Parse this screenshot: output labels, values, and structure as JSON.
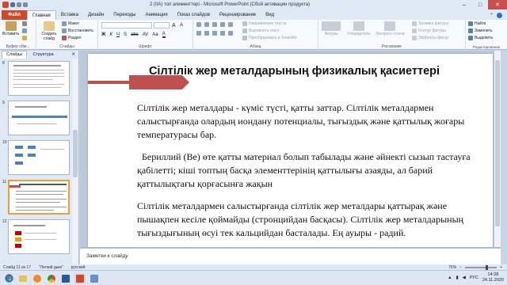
{
  "window": {
    "title": "2 (IIA) топ элементтері  -  Microsoft PowerPoint (Сбой активации продукта)",
    "controls": [
      "–",
      "□",
      "✕"
    ]
  },
  "ribbon_tabs": {
    "file": "Файл",
    "items": [
      "Главная",
      "Вставка",
      "Дизайн",
      "Переходы",
      "Анимация",
      "Показ слайдов",
      "Рецензирование",
      "Вид"
    ],
    "active_index": 0
  },
  "ribbon": {
    "clipboard": {
      "paste": "Вставить",
      "label": "Буфер обм..."
    },
    "slides": {
      "new_slide": "Создать слайд",
      "layout": "Макет",
      "reset": "Восстановить",
      "section": "Раздел",
      "label": "Слайды"
    },
    "font": {
      "label": "Шрифт"
    },
    "paragraph": {
      "text_direction": "Направление текста",
      "align_text": "Выровнять текст",
      "smartart": "Преобразовать в SmartArt",
      "label": "Абзац"
    },
    "drawing": {
      "shapes": "Фигуры",
      "arrange": "Упорядочить",
      "quick_styles": "Экспресс-стили",
      "fill": "Заливка фигуры",
      "outline": "Контур фигуры",
      "effects": "Эффекты фигур",
      "label": "Рисование"
    },
    "editing": {
      "find": "Найти",
      "replace": "Заменить",
      "select": "Выделить",
      "label": "Редактирование"
    }
  },
  "left_panel": {
    "tabs": [
      "Слайды",
      "Структура"
    ],
    "slides": [
      {
        "num": "8"
      },
      {
        "num": "9"
      },
      {
        "num": "10"
      },
      {
        "num": "11",
        "selected": true
      },
      {
        "num": "12"
      }
    ]
  },
  "slide": {
    "title": "Сілтілік жер металдарының физикалық қасиеттері",
    "paragraphs": [
      "Сілтілік жер металдары - күміс түсті, қатты заттар. Сілтілік металдармен салыстырғанда олардың иондану потенциалы, тығыздық және қаттылық жоғары температурасы бар.",
      "Бериллий (Ве) өте қатты материал болып табылады және әйнекті сызып тастауға қабілетті; кіші топтың басқа элементтерінің қаттылығы азаяды, ал барий қаттылықтағы қорғасынға жақын",
      "Сілтілік металдармен салыстырғанда сілтілік жер металдары қаттырақ және пышақпен кесіле қоймайды (стронцийдан басқасы). Сілтілік жер металдарының тығыздығының өсуі тек кальцийдан басталады. Ең ауыры - радий."
    ]
  },
  "notes": {
    "placeholder": "Заметки к слайду"
  },
  "status": {
    "slide_info": "Слайд 11 из 17",
    "theme": "\"Легкий дым\"",
    "language": "русский",
    "zoom": "76%"
  },
  "taskbar": {
    "lang": "РУС",
    "time": "14:28",
    "date": "24.11.2020"
  }
}
